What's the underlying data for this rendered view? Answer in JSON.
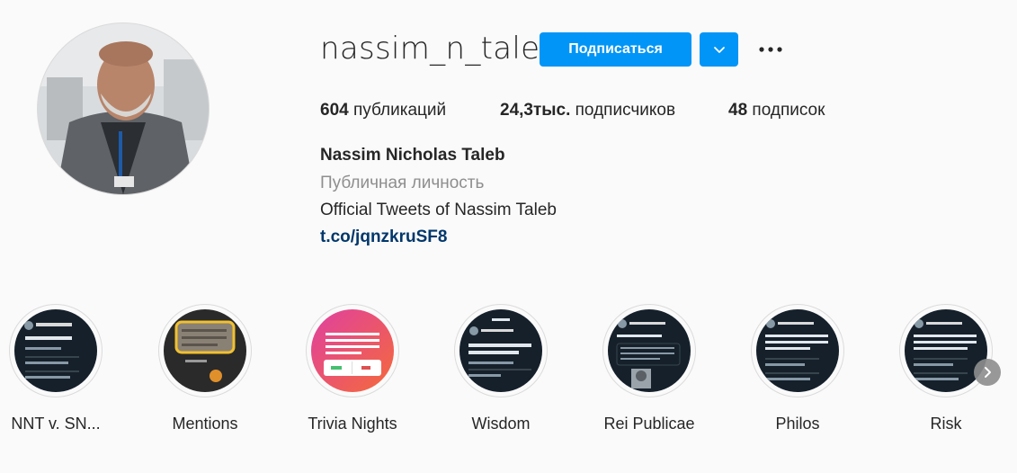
{
  "profile": {
    "username": "nassim_n_taleb",
    "follow_label": "Подписаться",
    "stats": {
      "posts_count": "604",
      "posts_label": "публикаций",
      "followers_count": "24,3тыс.",
      "followers_label": "подписчиков",
      "following_count": "48",
      "following_label": "подписок"
    },
    "full_name": "Nassim Nicholas Taleb",
    "category": "Публичная личность",
    "bio": "Official Tweets of Nassim Taleb",
    "link": "t.co/jqnzkruSF8"
  },
  "highlights": [
    {
      "label": "NNT v. SN..."
    },
    {
      "label": "Mentions"
    },
    {
      "label": "Trivia Nights"
    },
    {
      "label": "Wisdom"
    },
    {
      "label": "Rei Publicae"
    },
    {
      "label": "Philos"
    },
    {
      "label": "Risk"
    }
  ],
  "colors": {
    "accent": "#0095f6",
    "link": "#00376b",
    "secondary_text": "#8e8e8e",
    "background": "#fafafa"
  },
  "icons": {
    "dropdown": "chevron-down-icon",
    "more": "more-horizontal-icon",
    "next": "chevron-right-icon"
  }
}
